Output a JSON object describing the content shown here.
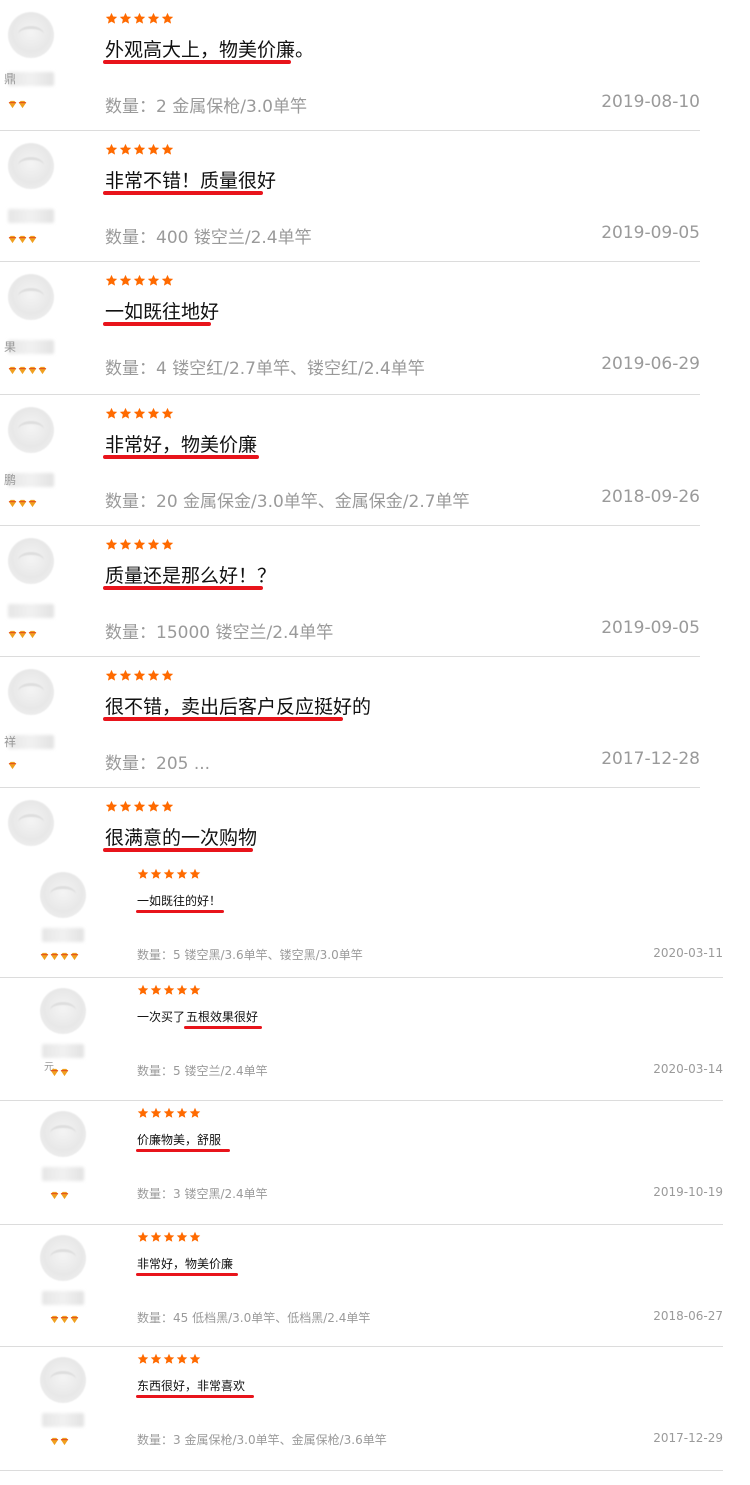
{
  "colors": {
    "star": "#ff6a00",
    "underline": "#e8141b",
    "meta": "#9a9a9a",
    "divider": "#dcdcdc"
  },
  "reviews": [
    {
      "stars": 5,
      "comment": "外观高大上，物美价廉。",
      "meta": "数量：2  金属保枪/3.0单竿",
      "date": "2019-08-10",
      "nick": "鼎",
      "badge_count": 2
    },
    {
      "stars": 5,
      "comment": "非常不错！质量很好",
      "meta": "数量：400  镂空兰/2.4单竿",
      "date": "2019-09-05",
      "nick": "",
      "badge_count": 3
    },
    {
      "stars": 5,
      "comment": "一如既往地好",
      "meta": "数量：4  镂空红/2.7单竿、镂空红/2.4单竿",
      "date": "2019-06-29",
      "nick": "果",
      "badge_count": 4
    },
    {
      "stars": 5,
      "comment": "非常好，物美价廉",
      "meta": "数量：20  金属保金/3.0单竿、金属保金/2.7单竿",
      "date": "2018-09-26",
      "nick": "鹏",
      "badge_count": 3
    },
    {
      "stars": 5,
      "comment": "质量还是那么好！？",
      "meta": "数量：15000  镂空兰/2.4单竿",
      "date": "2019-09-05",
      "nick": "",
      "badge_count": 3
    },
    {
      "stars": 5,
      "comment": "很不错，卖出后客户反应挺好的",
      "meta": "数量：205 ...",
      "date": "2017-12-28",
      "nick": "祥",
      "badge_count": 1
    },
    {
      "stars": 5,
      "comment": "很满意的一次购物",
      "meta": "",
      "date": "",
      "nick": "",
      "badge_count": 0
    }
  ],
  "small_reviews": [
    {
      "stars": 5,
      "comment": "一如既往的好！",
      "meta": "数量：5  镂空黑/3.6单竿、镂空黑/3.0单竿",
      "date": "2020-03-11",
      "nick": "",
      "badge_count": 4
    },
    {
      "stars": 5,
      "comment_plain": "一次买了",
      "comment": "五根效果很好",
      "meta": "数量：5  镂空兰/2.4单竿",
      "date": "2020-03-14",
      "nick": "元",
      "badge_count": 2
    },
    {
      "stars": 5,
      "comment": "价廉物美，舒服",
      "meta": "数量：3  镂空黑/2.4单竿",
      "date": "2019-10-19",
      "nick": "",
      "badge_count": 2
    },
    {
      "stars": 5,
      "comment": "非常好，物美价廉",
      "meta": "数量：45  低档黑/3.0单竿、低档黑/2.4单竿",
      "date": "2018-06-27",
      "nick": "",
      "badge_count": 3
    },
    {
      "stars": 5,
      "comment": "东西很好，非常喜欢",
      "meta": "数量：3  金属保枪/3.0单竿、金属保枪/3.6单竿",
      "date": "2017-12-29",
      "nick": "",
      "badge_count": 2
    }
  ]
}
